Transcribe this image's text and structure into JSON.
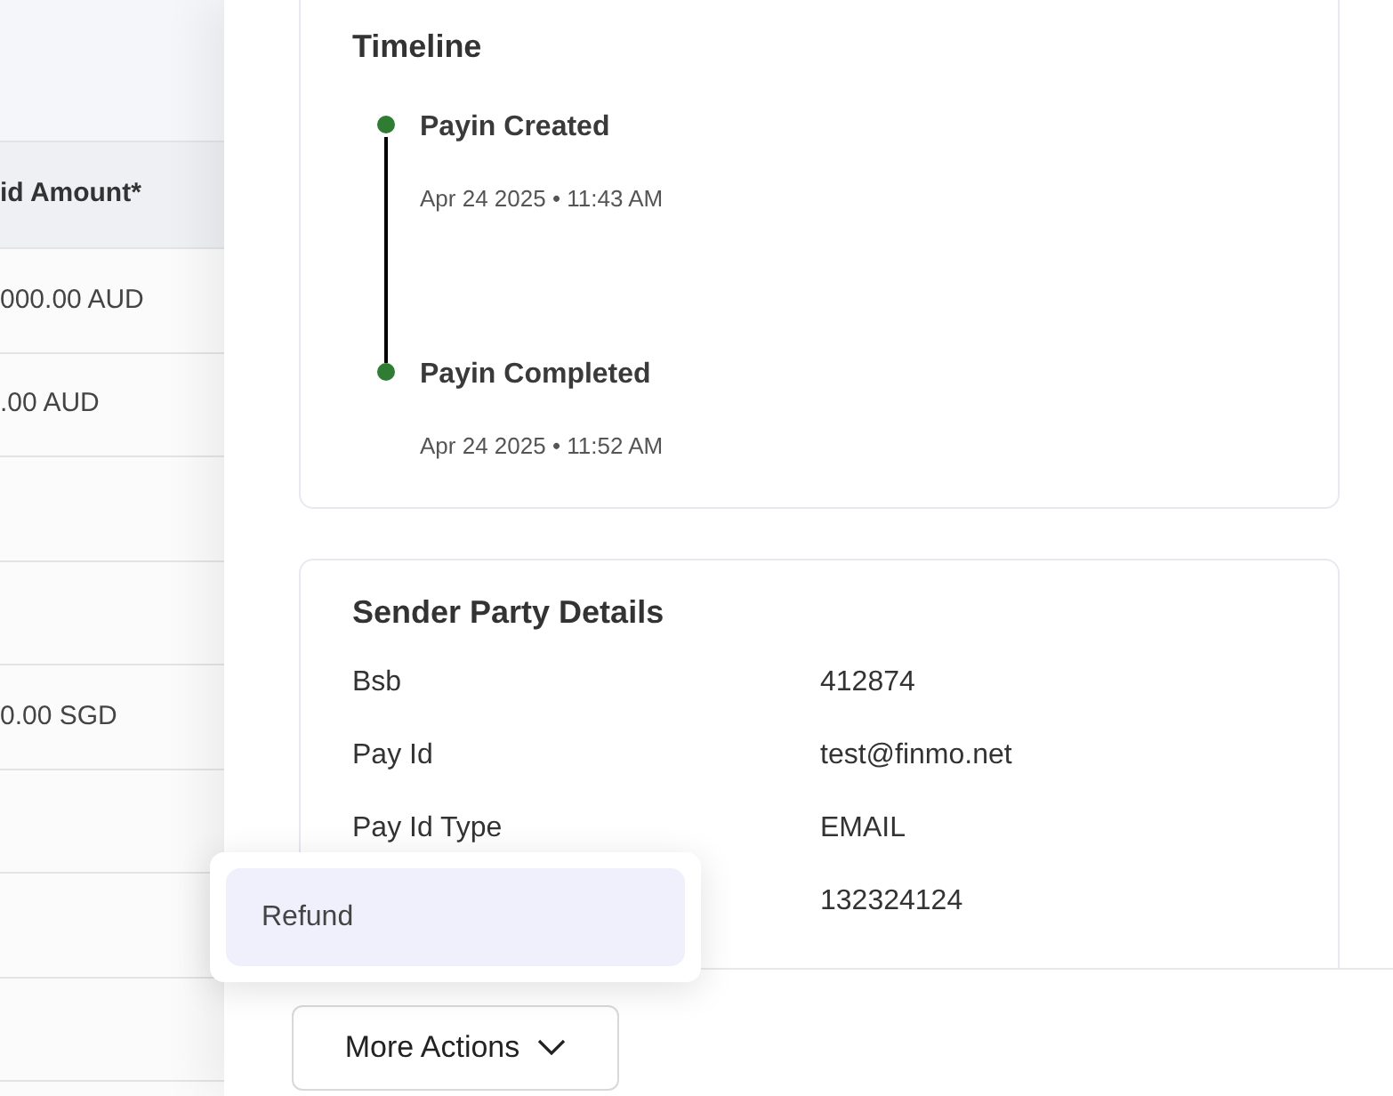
{
  "table": {
    "header": "id Amount*",
    "rows": [
      "000.00 AUD",
      ".00 AUD",
      "",
      "",
      "0.00 SGD",
      "",
      "",
      ""
    ]
  },
  "timeline": {
    "title": "Timeline",
    "events": [
      {
        "title": "Payin Created",
        "time": "Apr 24 2025 • 11:43 AM",
        "color": "#2e7d32"
      },
      {
        "title": "Payin Completed",
        "time": "Apr 24 2025 • 11:52 AM",
        "color": "#2e7d32"
      }
    ]
  },
  "sender_party": {
    "title": "Sender Party Details",
    "fields": [
      {
        "label": "Bsb",
        "value": "412874"
      },
      {
        "label": "Pay Id",
        "value": "test@finmo.net"
      },
      {
        "label": "Pay Id Type",
        "value": "EMAIL"
      },
      {
        "value": "132324124"
      }
    ]
  },
  "menu": {
    "items": [
      {
        "label": "Refund",
        "selected": true
      }
    ]
  },
  "more_actions": {
    "label": "More Actions"
  }
}
